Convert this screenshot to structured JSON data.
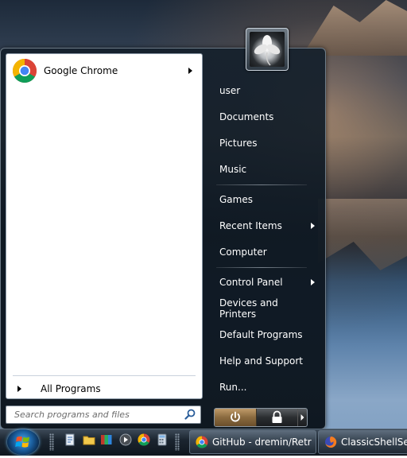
{
  "start_menu": {
    "pinned": [
      {
        "label": "Google Chrome",
        "icon": "google-chrome-icon",
        "has_submenu": true
      }
    ],
    "all_programs_label": "All Programs",
    "search": {
      "placeholder": "Search programs and files",
      "value": ""
    },
    "right_items": [
      {
        "label": "user",
        "name": "right-item-user"
      },
      {
        "label": "Documents",
        "name": "right-item-documents"
      },
      {
        "label": "Pictures",
        "name": "right-item-pictures"
      },
      {
        "label": "Music",
        "name": "right-item-music"
      },
      {
        "label": "Games",
        "name": "right-item-games"
      },
      {
        "label": "Recent Items",
        "name": "right-item-recent-items",
        "has_submenu": true
      },
      {
        "label": "Computer",
        "name": "right-item-computer"
      },
      {
        "label": "Control Panel",
        "name": "right-item-control-panel",
        "has_submenu": true
      },
      {
        "label": "Devices and Printers",
        "name": "right-item-devices-and-printers"
      },
      {
        "label": "Default Programs",
        "name": "right-item-default-programs"
      },
      {
        "label": "Help and Support",
        "name": "right-item-help-and-support"
      },
      {
        "label": "Run...",
        "name": "right-item-run"
      }
    ],
    "buttons": {
      "shutdown_icon": "power-icon",
      "lock_icon": "lock-icon",
      "options_icon": "chevron-right-icon"
    }
  },
  "taskbar": {
    "quick_launch": [
      "document-icon",
      "folder-icon",
      "archive-icon",
      "media-icon",
      "chrome-icon",
      "calculator-icon"
    ],
    "tasks": [
      {
        "label": "GitHub - dremin/Retr",
        "icon": "chrome-icon"
      },
      {
        "label": "ClassicShellSetup",
        "icon": "firefox-icon"
      }
    ]
  },
  "colors": {
    "menu_bg": "#14202c",
    "left_pane_bg": "#ffffff",
    "shutdown_accent": "#a88457",
    "taskbar_bg": "#1b2530"
  }
}
